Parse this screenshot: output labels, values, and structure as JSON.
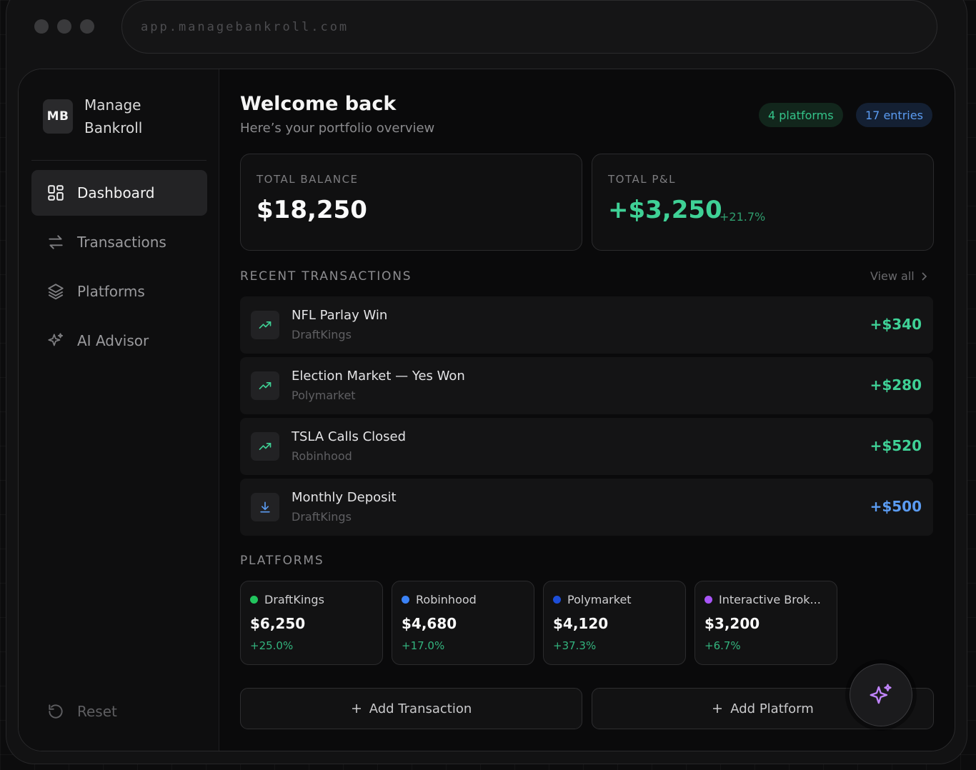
{
  "browser": {
    "url": "app.managebankroll.com"
  },
  "brand": {
    "logo_text": "MB",
    "name_line1": "Manage",
    "name_line2": "Bankroll"
  },
  "nav": {
    "items": [
      {
        "label": "Dashboard",
        "icon": "grid-icon",
        "active": true
      },
      {
        "label": "Transactions",
        "icon": "arrows-swap-icon",
        "active": false
      },
      {
        "label": "Platforms",
        "icon": "layers-icon",
        "active": false
      },
      {
        "label": "AI Advisor",
        "icon": "sparkle-icon",
        "active": false
      }
    ],
    "reset_label": "Reset"
  },
  "header": {
    "title": "Welcome back",
    "subtitle": "Here’s your portfolio overview",
    "badge_platforms": "4 platforms",
    "badge_entries": "17 entries"
  },
  "stats": {
    "balance_label": "TOTAL BALANCE",
    "balance_value": "$18,250",
    "pnl_label": "TOTAL P&L",
    "pnl_value": "+$3,250",
    "pnl_pct": "+21.7%"
  },
  "recent": {
    "title": "RECENT TRANSACTIONS",
    "view_all": "View all",
    "items": [
      {
        "title": "NFL Parlay Win",
        "platform": "DraftKings",
        "amount": "+$340",
        "type": "gain"
      },
      {
        "title": "Election Market — Yes Won",
        "platform": "Polymarket",
        "amount": "+$280",
        "type": "gain"
      },
      {
        "title": "TSLA Calls Closed",
        "platform": "Robinhood",
        "amount": "+$520",
        "type": "gain"
      },
      {
        "title": "Monthly Deposit",
        "platform": "DraftKings",
        "amount": "+$500",
        "type": "deposit"
      }
    ]
  },
  "platforms": {
    "title": "PLATFORMS",
    "items": [
      {
        "name": "DraftKings",
        "value": "$6,250",
        "pct": "+25.0%",
        "color": "#22c55e"
      },
      {
        "name": "Robinhood",
        "value": "$4,680",
        "pct": "+17.0%",
        "color": "#3b82f6"
      },
      {
        "name": "Polymarket",
        "value": "$4,120",
        "pct": "+37.3%",
        "color": "#1d4ed8"
      },
      {
        "name": "Interactive Brok...",
        "value": "$3,200",
        "pct": "+6.7%",
        "color": "#a855f7"
      }
    ]
  },
  "actions": {
    "add_transaction": "Add Transaction",
    "add_platform": "Add Platform"
  },
  "colors": {
    "gain": "#3fd196",
    "deposit": "#5b9cf2",
    "accent_purple": "#c084fc"
  }
}
